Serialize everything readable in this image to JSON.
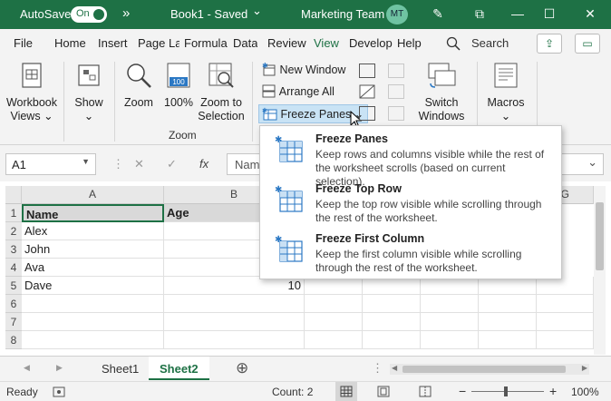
{
  "titlebar": {
    "autosave_label": "AutoSave",
    "autosave_state": "On",
    "more_glyph": "»",
    "doc_title": "Book1 - Saved",
    "doc_dropdown_glyph": "⌄",
    "account_name": "Marketing Team",
    "avatar_initials": "MT",
    "pen_glyph": "✎",
    "restore_glyph": "⧉",
    "minimize_glyph": "—",
    "maximize_glyph": "☐",
    "close_glyph": "✕"
  },
  "tabs": [
    {
      "label": "File"
    },
    {
      "label": "Home"
    },
    {
      "label": "Insert"
    },
    {
      "label": "Page La"
    },
    {
      "label": "Formula"
    },
    {
      "label": "Data"
    },
    {
      "label": "Review"
    },
    {
      "label": "View"
    },
    {
      "label": "Develop"
    },
    {
      "label": "Help"
    }
  ],
  "active_tab": "View",
  "search": {
    "label": "Search",
    "icon": "search-icon"
  },
  "share_icon_glyph": "⇪",
  "comments_icon_glyph": "▭",
  "ribbon": {
    "workbook_views": {
      "line1": "Workbook",
      "line2": "Views",
      "caret": "⌄"
    },
    "show": {
      "label": "Show",
      "caret": "⌄"
    },
    "zoom": {
      "label": "Zoom"
    },
    "zoom100": {
      "label": "100%",
      "badge": "100"
    },
    "zoom_to_selection": {
      "line1": "Zoom to",
      "line2": "Selection"
    },
    "zoom_group_label": "Zoom",
    "new_window": "New Window",
    "arrange_all": "Arrange All",
    "freeze_panes": "Freeze Panes",
    "freeze_panes_caret": "⌄",
    "switch_windows": {
      "line1": "Switch",
      "line2": "Windows",
      "caret": "⌄"
    },
    "macros": {
      "label": "Macros",
      "caret": "⌄"
    }
  },
  "formula_bar": {
    "name_box": "A1",
    "name_box_caret": "▼",
    "cancel_glyph": "✕",
    "enter_glyph": "✓",
    "fx": "fx",
    "content": "Nam",
    "expand_glyph": "⌄"
  },
  "grid": {
    "columns": [
      "A",
      "B",
      "G"
    ],
    "rows": [
      "1",
      "2",
      "3",
      "4",
      "5",
      "6",
      "7",
      "8"
    ],
    "cells": {
      "a1": "Name",
      "b1": "Age",
      "a2": "Alex",
      "a3": "John",
      "a4": "Ava",
      "a5": "Dave",
      "b5": "10"
    }
  },
  "sheets": {
    "nav_prev": "◀",
    "nav_next": "▶",
    "tabs": [
      "Sheet1",
      "Sheet2"
    ],
    "active": "Sheet2",
    "add_glyph": "⊕",
    "more_glyph": "⋮",
    "scroll_left": "◀",
    "scroll_right": "▶"
  },
  "status": {
    "ready": "Ready",
    "count": "Count: 2",
    "zoom_minus": "−",
    "zoom_plus": "+",
    "zoom_level": "100%"
  },
  "freeze_menu": [
    {
      "title": "Freeze Panes",
      "desc": "Keep rows and columns visible while the rest of the worksheet scrolls (based on current selection)."
    },
    {
      "title": "Freeze Top Row",
      "desc": "Keep the top row visible while scrolling through the rest of the worksheet."
    },
    {
      "title": "Freeze First Column",
      "desc": "Keep the first column visible while scrolling through the rest of the worksheet."
    }
  ],
  "colors": {
    "brand": "#1e7145",
    "icon_blue": "#2b78c4"
  }
}
